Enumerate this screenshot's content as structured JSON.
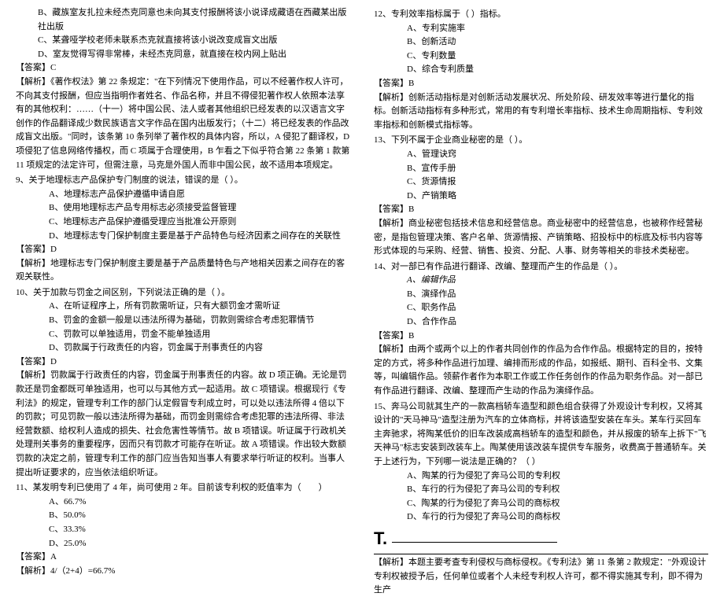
{
  "left": {
    "p1": "B、藏族室友扎拉未经杰克同意也未向其支付报酬将该小说译成藏语在西藏某出版社出版",
    "p2": "C、某聋哑学校老师未联系杰克就直接将该小说改变成盲文出版",
    "p3": "D、室友觉得写得非常棒，未经杰克同意，就直接在校内网上贴出",
    "ans1": "【答案】C",
    "exp1": "【解析】《著作权法》第 22 条规定：\"在下列情况下使用作品，可以不经著作权人许可，不向其支付报酬，但应当指明作者姓名、作品名称，并且不得侵犯著作权人依照本法享有的其他权利：……（十一）将中国公民、法人或者其他组织已经发表的以汉语言文字创作的作品翻译成少数民族语言文字作品在国内出版发行；（十二）将已经发表的作品改成盲文出版。\"同时，该条第 10 条列举了著作权的具体内容，所以，A 侵犯了翻译权，D 项侵犯了信息网络传播权，而 C 项属于合理使用，B 乍看之下似乎符合第 22 条第 1 款第 11 项规定的法定许可，但需注意，马克是外国人而非中国公民，故不适用本项规定。",
    "q9": "9、关于地理标志产品保护专门制度的说法，错误的是（ ）。",
    "q9a": "A、地理标志产品保护遵循申请自愿",
    "q9b": "B、使用地理标志产品专用标志必须接受监督管理",
    "q9c": "C、地理标志产品保护遵循受理应当批准公开原则",
    "q9d": "D、地理标志专门保护制度主要是基于产品特色与经济因素之间存在的关联性",
    "ans9": "【答案】D",
    "exp9": "【解析】地理标志专门保护制度主要是基于产品质量特色与产地相关因素之间存在的客观关联性。",
    "q10": "10、关于加款与罚金之间区别，下列说法正确的是（ ）。",
    "q10a": "A、在听证程序上，所有罚款需听证，只有大额罚金才需听证",
    "q10b": "B、罚金的金额一般是以违法所得为基础，罚款则需综合考虑犯罪情节",
    "q10c": "C、罚款可以单独适用，罚金不能单独适用",
    "q10d": "D、罚款属于行政责任的内容，罚金属于刑事责任的内容",
    "ans10": "【答案】D",
    "exp10": "【解析】罚款属于行政责任的内容，罚金属于刑事责任的内容。故 D 项正确。无论是罚款还是罚金都既可单独适用，也可以与其他方式一起适用。故 C 项错误。根据现行《专利法》的规定，管理专利工作的部门认定假冒专利成立时，可以处以违法所得 4 倍以下的罚款；可见罚款一般以违法所得为基础，而罚金则需综合考虑犯罪的违法所得、非法经营数额、给权利人造成的损失、社会危害性等情节。故 B 项错误。听证属于行政机关处理刑关事务的重要程序，因而只有罚款才可能存在听证。故 A 项错误。作出较大数额罚款的决定之前，管理专利工作的部门应当告知当事人有要求举行听证的权利。当事人提出听证要求的，应当依法组织听证。",
    "q11": "11、某发明专利已使用了 4 年，尚可使用 2 年。目前该专利权的贬值率为（　　）",
    "q11a": "A、66.7%",
    "q11b": "B、50.0%",
    "q11c": "C、33.3%",
    "q11d": "D、25.0%",
    "ans11": "【答案】A",
    "exp11": "【解析】4/（2+4）=66.7%"
  },
  "right": {
    "q12": "12、专利效率指标属于（ ）指标。",
    "q12a": "A、专利实施率",
    "q12b": "B、创新活动",
    "q12c": "C、专利数量",
    "q12d": "D、综合专利质量",
    "ans12": "【答案】B",
    "exp12": "【解析】创新活动指标是对创新活动发展状况、所处阶段、研发效率等进行量化的指标。创新活动指标有多种形式，常用的有专利增长率指标、技术生命周期指标、专利效率指标和创新模式指标等。",
    "q13": "13、下列不属于企业商业秘密的是（ ）。",
    "q13a": "A、管理诀窍",
    "q13b": "B、宣传手册",
    "q13c": "C、货源情报",
    "q13d": "D、产销策略",
    "ans13": "【答案】B",
    "exp13": "【解析】商业秘密包括技术信息和经营信息。商业秘密中的经营信息，也被称作经营秘密，是指包管理决策、客户名单、货源情报、产销策略、招投标中的标底及标书内容等形式体现的与采购、经营、销售、投资、分配、人事、财务等相关的非技术类秘密。",
    "q14": "14、对一部已有作品进行翻译、改编、整理而产生的作品是（ ）。",
    "q14a": "A、编辑作品",
    "q14b": "B、演绎作品",
    "q14c": "C、职务作品",
    "q14d": "D、合作作品",
    "ans14": "【答案】B",
    "exp14": "【解析】由两个或两个以上的作者共同创作的作品为合作作品。根据特定的目的，按特定的方式，将多种作品进行加理、编排而形成的作品，如报纸、期刊、百科全书、文集等，叫编辑作品。领薪作者作为本职工作或工作任务创作的作品为职务作品。对一部已有作品进行翻译、改编、整理而产生动的作品为演绎作品。",
    "q15": "15、奔马公司就其生产的一款高档轿车造型和颜色组合获得了外观设计专利权，又将其设计的\"天马神马\"造型注册为汽车的立体商标，并将该造型安装在车头。某车行买回车主奔驰求，将陶某低价的旧车改装成高档轿车的造型和颜色，并从报废的轿车上拆下\"飞天神马\"标志安装到改装车上。陶某使用该改装车提供专车服务，收费高于普通轿车。关于上述行为，下列哪一说法是正确的？（ ）",
    "q15a": "A、陶某的行为侵犯了奔马公司的专利权",
    "q15b": "B、车行的行为侵犯了奔马公司的专利权",
    "q15c": "C、陶某的行为侵犯了奔马公司的商标权",
    "q15d": "D、车行的行为侵犯了奔马公司的商标权",
    "tmark": "T.",
    "exp15": "【解析】本题主要考查专利侵权与商标侵权。《专利法》第 11 条第 2 款规定：\"外观设计专利权被授予后，任何单位或者个人未经专利权人许可，都不得实施其专利，即不得为生产"
  }
}
